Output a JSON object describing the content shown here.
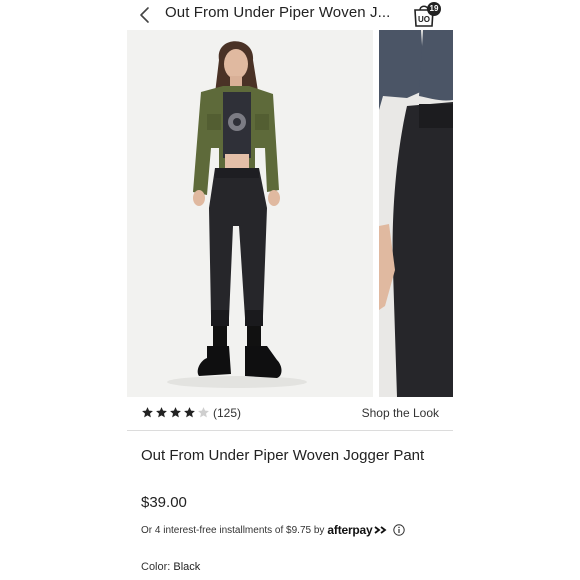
{
  "header": {
    "title": "Out From Under Piper Woven J...",
    "bag_count": "19",
    "bag_icon": "UO bag icon",
    "back_icon": "chevron-left"
  },
  "rating": {
    "stars_filled": 4,
    "stars_total": 5,
    "review_count": "(125)",
    "shop_the_look": "Shop the Look"
  },
  "product": {
    "name": "Out From Under Piper Woven Jogger Pant",
    "price": "$39.00",
    "installments_text": "Or 4 interest-free installments of $9.75 by",
    "afterpay_label": "afterpay",
    "color_label": "Color:",
    "color_value": "Black"
  },
  "colors": {
    "jacket": "#5e6a3a",
    "pants": "#26262a",
    "background": "#f2f2f0",
    "star": "#222222",
    "star_empty": "#cfcfcf"
  }
}
